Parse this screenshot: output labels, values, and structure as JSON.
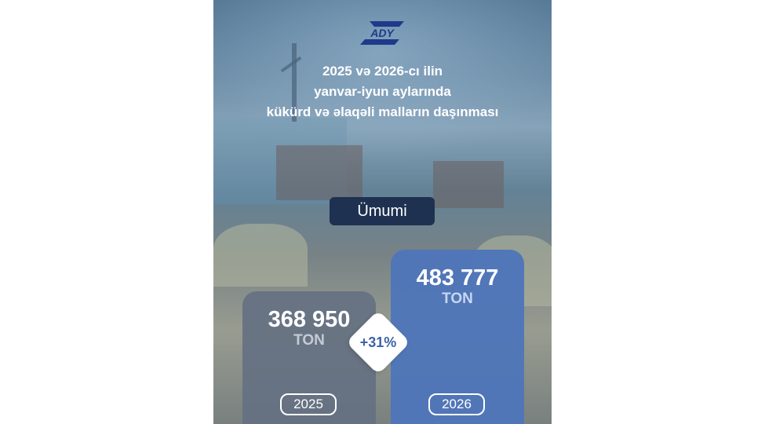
{
  "brand": {
    "logo_text": "ADY"
  },
  "title_lines": [
    "2025 və 2026-cı ilin",
    "yanvar-iyun aylarında",
    "kükürd və əlaqəli malların daşınması"
  ],
  "total_label": "Ümumi",
  "growth_label": "+31%",
  "colors": {
    "bar_2025": "#647082",
    "bar_2026": "#5076b9",
    "badge": "#1e3150",
    "growth_text": "#3e63a8"
  },
  "chart_data": {
    "type": "bar",
    "categories": [
      "2025",
      "2026"
    ],
    "values": [
      368950,
      483777
    ],
    "value_labels": [
      "368 950",
      "483 777"
    ],
    "unit": "TON",
    "title": "2025 və 2026-cı ilin yanvar-iyun aylarında kükürd və əlaqəli malların daşınması",
    "xlabel": "",
    "ylabel": "",
    "grid": false,
    "legend": "none"
  }
}
